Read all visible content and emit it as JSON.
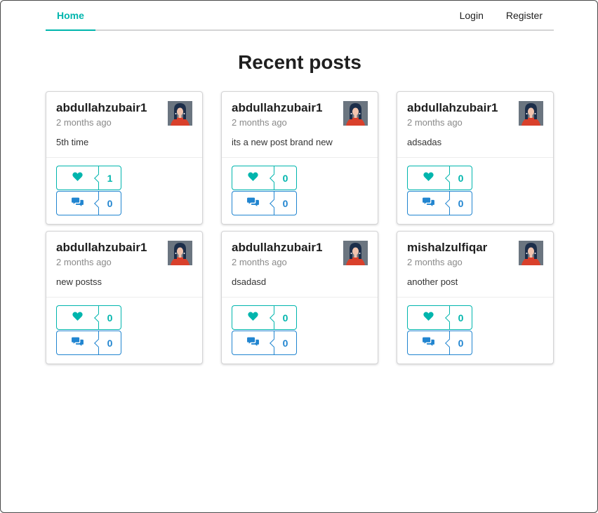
{
  "nav": {
    "home": "Home",
    "login": "Login",
    "register": "Register"
  },
  "page": {
    "title": "Recent posts"
  },
  "colors": {
    "teal": "#00b5ad",
    "blue": "#2185d0"
  },
  "posts": [
    {
      "username": "abdullahzubair1",
      "time": "2 months ago",
      "body": "5th time",
      "likes": "1",
      "comments": "0"
    },
    {
      "username": "abdullahzubair1",
      "time": "2 months ago",
      "body": "its a new post brand new",
      "likes": "0",
      "comments": "0"
    },
    {
      "username": "abdullahzubair1",
      "time": "2 months ago",
      "body": "adsadas",
      "likes": "0",
      "comments": "0"
    },
    {
      "username": "abdullahzubair1",
      "time": "2 months ago",
      "body": "new postss",
      "likes": "0",
      "comments": "0"
    },
    {
      "username": "abdullahzubair1",
      "time": "2 months ago",
      "body": "dsadasd",
      "likes": "0",
      "comments": "0"
    },
    {
      "username": "mishalzulfiqar",
      "time": "2 months ago",
      "body": "another post",
      "likes": "0",
      "comments": "0"
    }
  ]
}
